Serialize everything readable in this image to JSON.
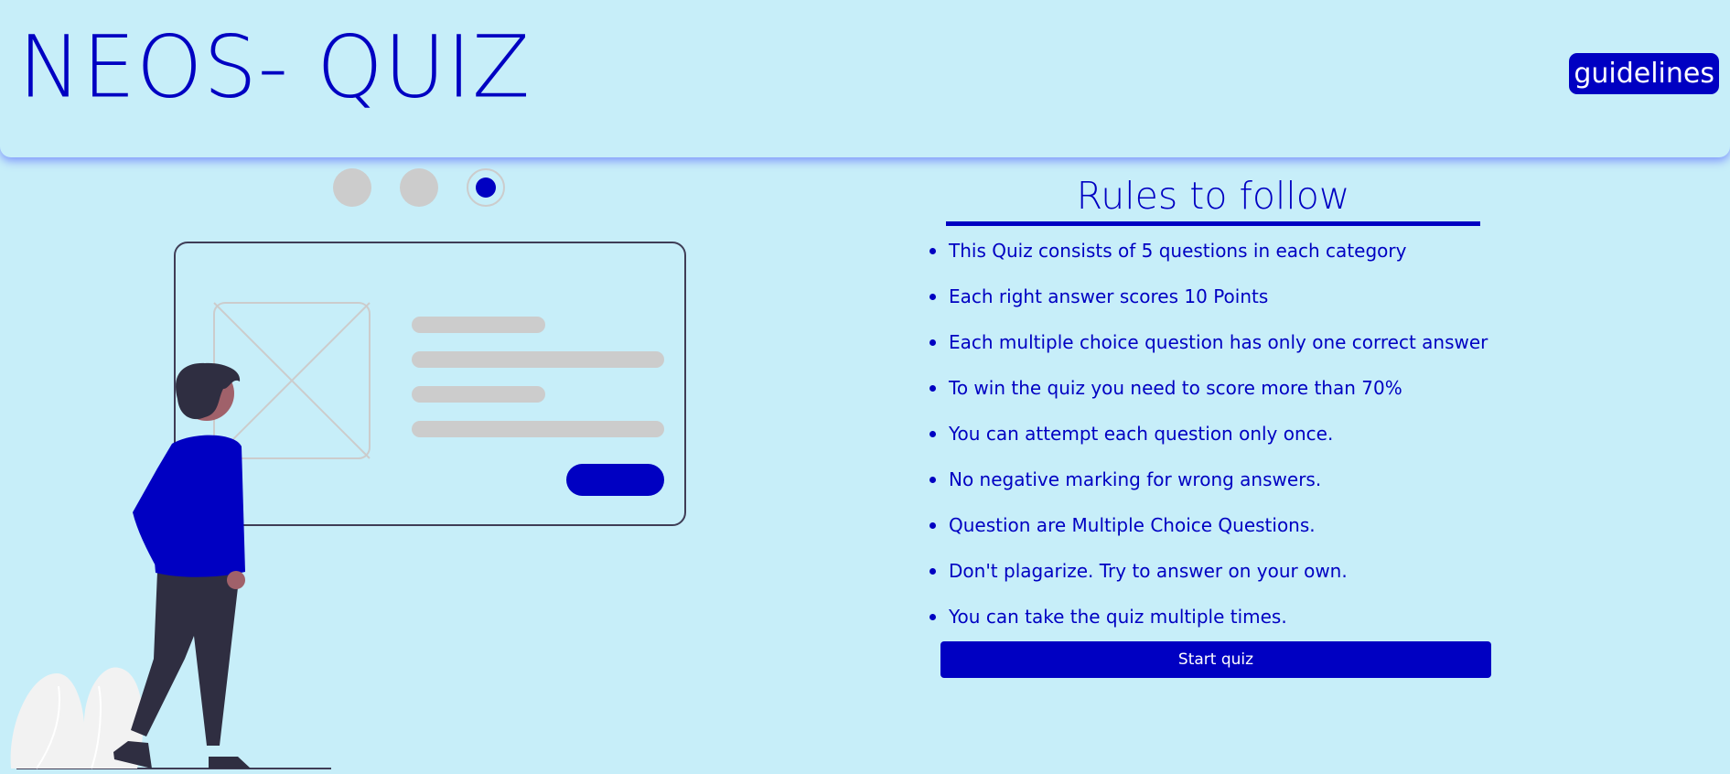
{
  "header": {
    "title": "NEOS- QUIZ",
    "guidelines_label": "guidelines"
  },
  "carousel": {
    "dots": [
      "slide-1",
      "slide-2",
      "slide-3"
    ],
    "active_index": 2
  },
  "rules": {
    "title": "Rules to follow",
    "items": [
      "This Quiz consists of 5 questions in each category",
      "Each right answer scores 10 Points",
      "Each multiple choice question has only one correct answer",
      "To win the quiz you need to score more than 70%",
      "You can attempt each question only once.",
      "No negative marking for wrong answers.",
      "Question are Multiple Choice Questions.",
      "Don't plagarize. Try to answer on your own.",
      "You can take the quiz multiple times."
    ],
    "start_label": "Start quiz"
  },
  "colors": {
    "background": "#c7eef9",
    "accent": "#0000c2",
    "inactive_dot": "#cccccc"
  },
  "icons": [
    "person-at-card-illustration"
  ]
}
